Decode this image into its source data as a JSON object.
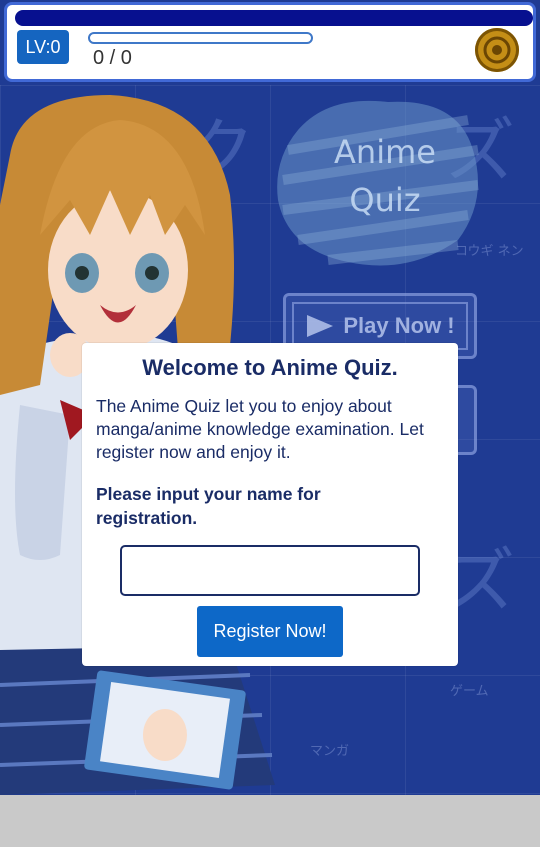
{
  "header": {
    "level_label": "LV:0",
    "progress_text": "0 / 0",
    "progress_fraction": 0,
    "coin_icon": "coin-icon"
  },
  "menu": {
    "title_line1": "Anime",
    "title_line2": "Quiz",
    "play_label": "Play Now !"
  },
  "dialog": {
    "title": "Welcome to Anime Quiz.",
    "body": "The Anime Quiz let you to enjoy about manga/anime knowledge examination. Let register now and enjoy it.",
    "prompt": "Please input your name for registration.",
    "name_value": "",
    "name_placeholder": "",
    "register_label": "Register Now!"
  },
  "colors": {
    "background": "#1f3b93",
    "header_border": "#4169d6",
    "header_bar": "#07108f",
    "level_badge": "#1565c0",
    "register_button": "#0d68c8",
    "dialog_text": "#1a2c66",
    "coin": "#c48e16"
  }
}
